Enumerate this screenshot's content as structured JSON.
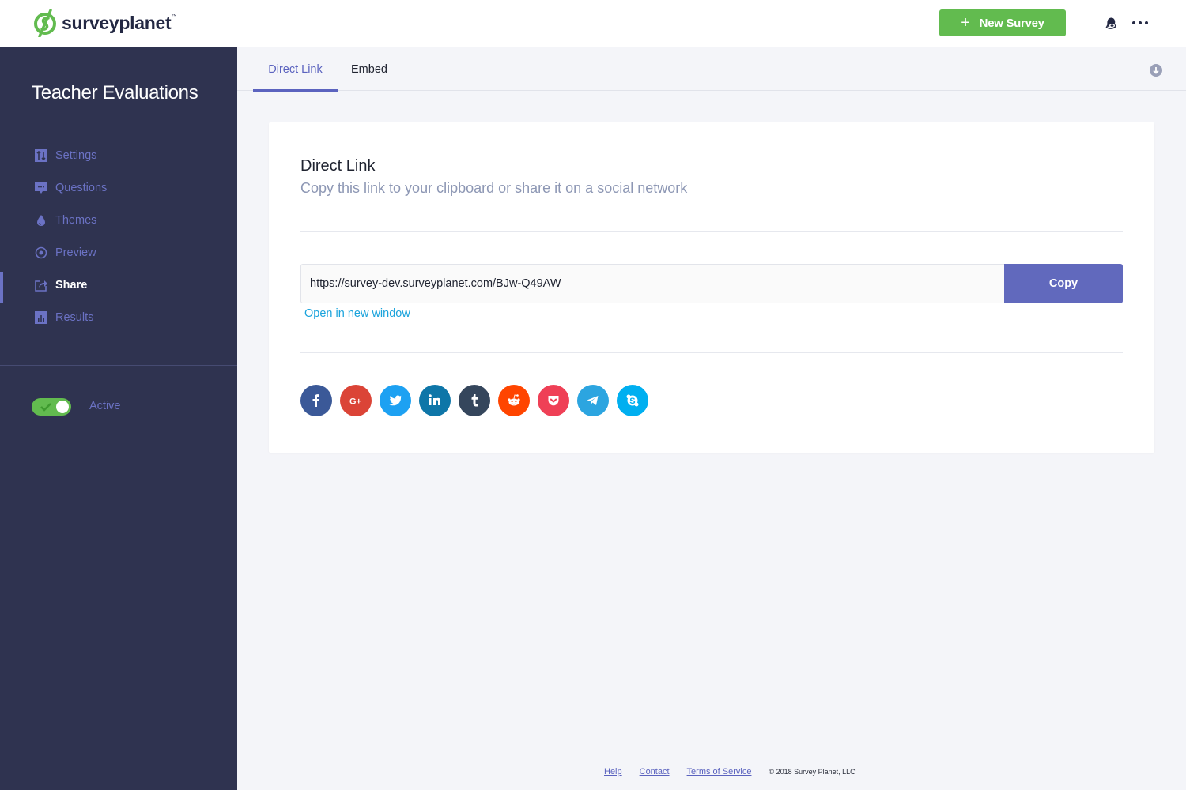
{
  "header": {
    "logo_text": "surveyplanet",
    "logo_tm": "™",
    "new_survey_label": "New Survey",
    "new_survey_icon": "plus-icon",
    "notifications_icon": "bell-icon",
    "more_icon": "more-horizontal-icon",
    "brand_color": "#62bb4f"
  },
  "sidebar": {
    "survey_title": "Teacher Evaluations",
    "items": [
      {
        "label": "Settings",
        "icon": "sliders-icon",
        "active": false
      },
      {
        "label": "Questions",
        "icon": "speech-bubble-icon",
        "active": false
      },
      {
        "label": "Themes",
        "icon": "droplet-icon",
        "active": false
      },
      {
        "label": "Preview",
        "icon": "eye-icon",
        "active": false
      },
      {
        "label": "Share",
        "icon": "share-icon",
        "active": true
      },
      {
        "label": "Results",
        "icon": "bar-chart-icon",
        "active": false
      }
    ],
    "status_toggle": {
      "label": "Active",
      "on": true
    },
    "background_color": "#2f3350",
    "accent_color": "#6b72c4"
  },
  "tabs": {
    "items": [
      {
        "label": "Direct Link",
        "active": true
      },
      {
        "label": "Embed",
        "active": false
      }
    ],
    "download_icon": "download-circle-icon"
  },
  "card": {
    "title": "Direct Link",
    "subtitle": "Copy this link to your clipboard or share it on a social network",
    "url_value": "https://survey-dev.surveyplanet.com/BJw-Q49AW",
    "copy_label": "Copy",
    "open_link_label": "Open in new window",
    "socials": [
      {
        "name": "facebook",
        "color": "#3b5998"
      },
      {
        "name": "google-plus",
        "color": "#db4437"
      },
      {
        "name": "twitter",
        "color": "#1da1f2"
      },
      {
        "name": "linkedin",
        "color": "#0e76a8"
      },
      {
        "name": "tumblr",
        "color": "#35465c"
      },
      {
        "name": "reddit",
        "color": "#ff4500"
      },
      {
        "name": "pocket",
        "color": "#ef4056"
      },
      {
        "name": "telegram",
        "color": "#2ca5e0"
      },
      {
        "name": "skype",
        "color": "#00aff0"
      }
    ]
  },
  "footer": {
    "links": [
      "Help",
      "Contact",
      "Terms of Service"
    ],
    "copyright": "© 2018 Survey Planet, LLC"
  }
}
